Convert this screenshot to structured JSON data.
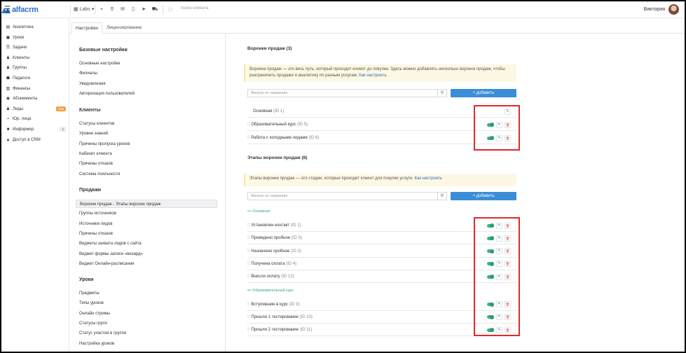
{
  "topbar": {
    "brand": "alfacrm",
    "branch": "Labs",
    "search_placeholder": "поиск клиента",
    "user_name": "Виктория"
  },
  "sidenav": {
    "items": [
      {
        "label": "Аналитика",
        "icon": "chart-icon"
      },
      {
        "label": "Уроки",
        "icon": "calendar-icon"
      },
      {
        "label": "Задачи",
        "icon": "tasks-icon"
      },
      {
        "label": "Клиенты",
        "icon": "user-icon"
      },
      {
        "label": "Группы",
        "icon": "users-icon"
      },
      {
        "label": "Педагоги",
        "icon": "teacher-icon"
      },
      {
        "label": "Финансы",
        "icon": "money-icon"
      },
      {
        "label": "Абонементы",
        "icon": "subscription-icon"
      },
      {
        "label": "Лиды",
        "icon": "leads-icon",
        "badge": "225",
        "badge_color": "#f0a04b"
      },
      {
        "label": "Юр. лица",
        "icon": "legal-icon"
      },
      {
        "label": "Информер",
        "icon": "informer-icon",
        "badge": "1",
        "badge_color": "#e9ecef"
      },
      {
        "label": "Доступ в CRM",
        "icon": "lock-icon"
      }
    ]
  },
  "tabs": [
    {
      "label": "Настройки",
      "active": true
    },
    {
      "label": "Лицензирование",
      "active": false
    }
  ],
  "settings": {
    "sections": [
      {
        "title": "Базовые настройки",
        "links": [
          "Основные настройки",
          "Филиалы",
          "Уведомления",
          "Авторизация пользователей"
        ]
      },
      {
        "title": "Клиенты",
        "links": [
          "Статусы клиентов",
          "Уровни знаний",
          "Причины пропуска уроков",
          "Кабинет клиента",
          "Причины отказов",
          "Система лояльности"
        ]
      },
      {
        "title": "Продажи",
        "links": [
          "Воронки продаж - Этапы воронок продаж",
          "Группы источников",
          "Источники лидов",
          "Причины отказов",
          "Виджеты захвата лидов с сайта",
          "Виджет формы записи «визард»",
          "Виджет Онлайн-расписания"
        ]
      },
      {
        "title": "Уроки",
        "links": [
          "Предметы",
          "Типы уроков",
          "Онлайн стримы",
          "Статусы групп",
          "Статус участия в группе",
          "Настройка уроков"
        ]
      }
    ],
    "active_link": "Воронки продаж - Этапы воронок продаж"
  },
  "funnels": {
    "title": "Воронки продаж (3)",
    "info_text": "Воронка продаж — это весь путь, который проходит клиент до покупки. Здесь можно добавлять несколько воронок продаж, чтобы разграничить продажи и аналитику по разным услугам.",
    "info_link": "Как настроить",
    "filter_placeholder": "Фильтр по названию",
    "add_label": "+ добавить",
    "rows": [
      {
        "name": "Основная",
        "id": "(ID 1)",
        "drag": false,
        "toggle": false,
        "delete": false
      },
      {
        "name": "Образовательный курс",
        "id": "(ID 5)",
        "drag": true,
        "toggle": true,
        "delete": true
      },
      {
        "name": "Работа с холодными лидами",
        "id": "(ID 6)",
        "drag": true,
        "toggle": true,
        "delete": true
      }
    ]
  },
  "stages": {
    "title": "Этапы воронки продаж (8)",
    "info_text": "Этапы воронки продаж — это стадии, которые проходит клиент для покупки услуги.",
    "info_link": "Как настроить",
    "filter_placeholder": "Фильтр по названию",
    "add_label": "+ добавить",
    "groups": [
      {
        "label": "••• Основная",
        "rows": [
          {
            "name": "Установлен контакт",
            "id": "(ID 1)"
          },
          {
            "name": "Проведено пробное",
            "id": "(ID 3)"
          },
          {
            "name": "Назначено пробное",
            "id": "(ID 2)"
          },
          {
            "name": "Получена оплата",
            "id": "(ID 4)"
          },
          {
            "name": "Внесли оплату",
            "id": "(ID 12)"
          }
        ]
      },
      {
        "label": "••• Образовательный курс",
        "rows": [
          {
            "name": "Вступившие в курс",
            "id": "(ID 9)"
          },
          {
            "name": "Прошли 1 тестирование",
            "id": "(ID 10)"
          },
          {
            "name": "Прошли 2 тестирование",
            "id": "(ID 11)"
          }
        ]
      }
    ]
  },
  "colors": {
    "accent": "#3a8ed8",
    "toggle_on": "#3db480",
    "highlight": "#e02a2a",
    "group_label": "#2eaa6e"
  }
}
